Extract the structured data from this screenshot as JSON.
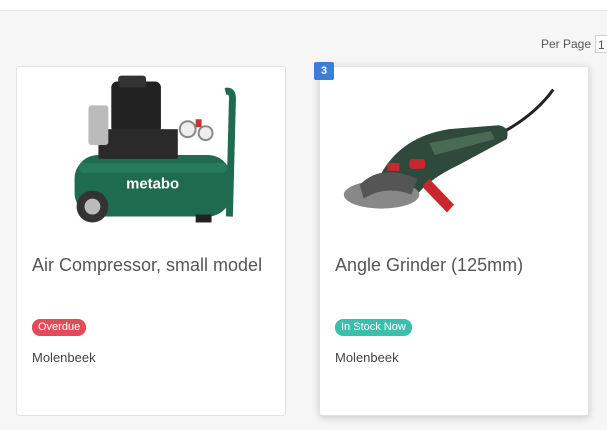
{
  "toolbar": {
    "per_page_label": "Per Page",
    "per_page_value": "1"
  },
  "items": [
    {
      "title": "Air Compressor, small model",
      "status": "Overdue",
      "location": "Molenbeek"
    },
    {
      "index_badge": "3",
      "title": "Angle Grinder (125mm)",
      "status": "In Stock Now",
      "location": "Molenbeek"
    }
  ],
  "brand_text": "metabo",
  "colors": {
    "overdue": "#e44b5a",
    "in_stock": "#3bbfad",
    "index_badge": "#3b7dd8",
    "compressor_green": "#1f6b4f",
    "grinder_green": "#2f4a3a"
  }
}
